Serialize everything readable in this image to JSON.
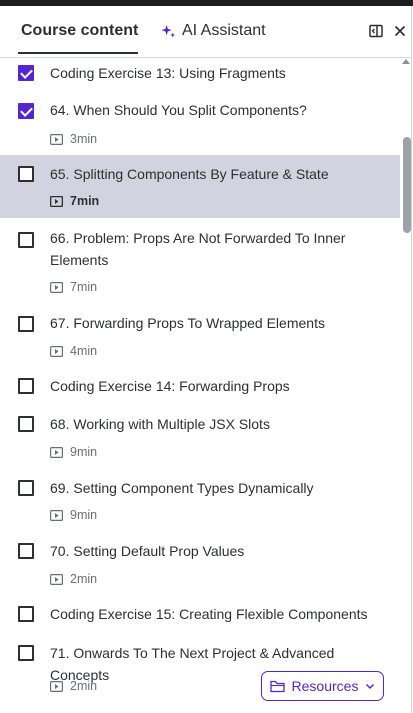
{
  "tabs": {
    "course_content": "Course content",
    "ai_assistant": "AI Assistant"
  },
  "header_icons": [
    "collapse-panel-icon",
    "close-icon"
  ],
  "items": [
    {
      "title": "Coding Exercise 13: Using Fragments",
      "checked": true
    },
    {
      "title": "64. When Should You Split Components?",
      "checked": true,
      "duration": "3min"
    },
    {
      "title": "65. Splitting Components By Feature & State",
      "checked": false,
      "duration": "7min",
      "active": true
    },
    {
      "title": "66. Problem: Props Are Not Forwarded To Inner Elements",
      "checked": false,
      "duration": "7min"
    },
    {
      "title": "67. Forwarding Props To Wrapped Elements",
      "checked": false,
      "duration": "4min"
    },
    {
      "title": "Coding Exercise 14: Forwarding Props",
      "checked": false
    },
    {
      "title": "68. Working with Multiple JSX Slots",
      "checked": false,
      "duration": "9min"
    },
    {
      "title": "69. Setting Component Types Dynamically",
      "checked": false,
      "duration": "9min"
    },
    {
      "title": "70. Setting Default Prop Values",
      "checked": false,
      "duration": "2min"
    },
    {
      "title": "Coding Exercise 15: Creating Flexible Components",
      "checked": false
    },
    {
      "title": "71. Onwards To The Next Project & Advanced Concepts",
      "checked": false,
      "duration": "2min"
    }
  ],
  "resources_button": {
    "label": "Resources",
    "icon": "folder-icon",
    "chevron": "chevron-down-icon"
  },
  "colors": {
    "accent": "#5624d0",
    "active_row": "#d1d4e0",
    "text": "#2d2f31",
    "muted": "#6a6f73"
  }
}
